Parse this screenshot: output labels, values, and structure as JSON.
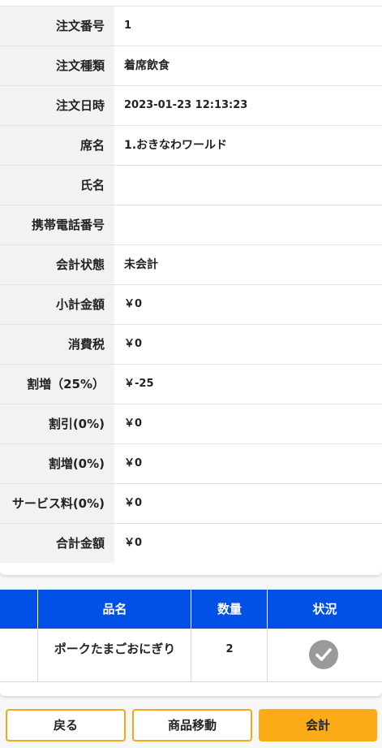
{
  "order_info": {
    "rows": [
      {
        "label": "注文番号",
        "value": "1"
      },
      {
        "label": "注文種類",
        "value": "着席飲食"
      },
      {
        "label": "注文日時",
        "value": "2023-01-23 12:13:23"
      },
      {
        "label": "席名",
        "value": "1.おきなわワールド"
      },
      {
        "label": "氏名",
        "value": ""
      },
      {
        "label": "携帯電話番号",
        "value": ""
      },
      {
        "label": "会計状態",
        "value": "未会計"
      },
      {
        "label": "小計金額",
        "value": "￥0"
      },
      {
        "label": "消費税",
        "value": "￥0"
      },
      {
        "label": "割増（25%）",
        "value": "￥-25"
      },
      {
        "label": "割引(0%)",
        "value": "￥0"
      },
      {
        "label": "割増(0%)",
        "value": "￥0"
      },
      {
        "label": "サービス料(0%)",
        "value": "￥0"
      },
      {
        "label": "合計金額",
        "value": "￥0"
      }
    ]
  },
  "items_table": {
    "headers": {
      "name": "品名",
      "qty": "数量",
      "status": "状況"
    },
    "rows": [
      {
        "name": "ポークたまごおにぎり",
        "qty": "2",
        "status_icon": "check-circle-icon"
      }
    ]
  },
  "actions": {
    "back_label": "戻る",
    "move_label": "商品移動",
    "checkout_label": "会計"
  },
  "colors": {
    "header_blue": "#0050e6",
    "accent_orange": "#fbab15",
    "status_gray": "#9a9a9a"
  }
}
